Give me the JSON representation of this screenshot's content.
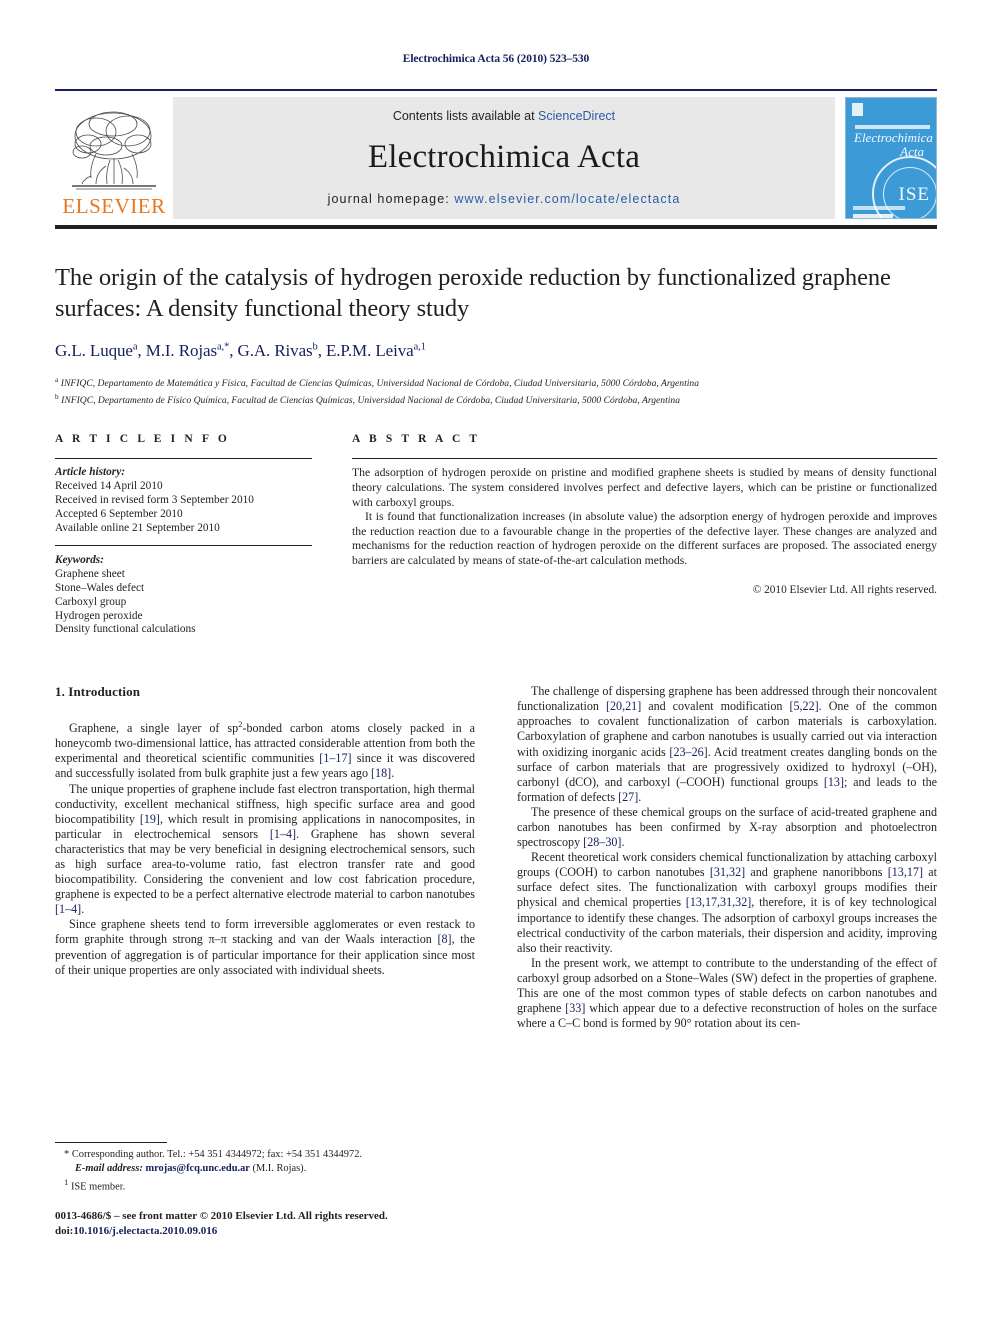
{
  "running_head": "Electrochimica Acta 56 (2010) 523–530",
  "masthead": {
    "publisher_name": "ELSEVIER",
    "contents_prefix": "Contents lists available at ",
    "contents_link": "ScienceDirect",
    "journal_name": "Electrochimica Acta",
    "homepage_prefix": "journal homepage: ",
    "homepage_url": "www.elsevier.com/locate/electacta",
    "cover": {
      "title_line1": "Electrochimica",
      "title_line2": "Acta",
      "society_mark": "ISE"
    },
    "accent_orange": "#e87722",
    "link_blue": "#2b5ca6",
    "rule_navy": "#16205c",
    "panel_grey": "#e8e8e8",
    "cover_blue": "#3c9bd6"
  },
  "article": {
    "title": "The origin of the catalysis of hydrogen peroxide reduction by functionalized graphene surfaces: A density functional theory study",
    "authors_html": "G.L. Luque<sup>a</sup>, M.I. Rojas<sup>a,</sup><sup>*</sup>, G.A. Rivas<sup>b</sup>, E.P.M. Leiva<sup>a,1</sup>",
    "affiliations": [
      {
        "marker": "a",
        "text": "INFIQC, Departamento de Matemática y Física, Facultad de Ciencias Químicas, Universidad Nacional de Córdoba, Ciudad Universitaria, 5000 Córdoba, Argentina"
      },
      {
        "marker": "b",
        "text": "INFIQC, Departamento de Físico Química, Facultad de Ciencias Químicas, Universidad Nacional de Córdoba, Ciudad Universitaria, 5000 Córdoba, Argentina"
      }
    ]
  },
  "article_info": {
    "heading": "A R T I C L E   I N F O",
    "history_label": "Article history:",
    "history": [
      "Received 14 April 2010",
      "Received in revised form 3 September 2010",
      "Accepted 6 September 2010",
      "Available online 21 September 2010"
    ],
    "keywords_label": "Keywords:",
    "keywords": [
      "Graphene sheet",
      "Stone–Wales defect",
      "Carboxyl group",
      "Hydrogen peroxide",
      "Density functional calculations"
    ]
  },
  "abstract": {
    "heading": "A B S T R A C T",
    "paragraph_1": "The adsorption of hydrogen peroxide on pristine and modified graphene sheets is studied by means of density functional theory calculations. The system considered involves perfect and defective layers, which can be pristine or functionalized with carboxyl groups.",
    "paragraph_2": "It is found that functionalization increases (in absolute value) the adsorption energy of hydrogen peroxide and improves the reduction reaction due to a favourable change in the properties of the defective layer. These changes are analyzed and mechanisms for the reduction reaction of hydrogen peroxide on the different surfaces are proposed. The associated energy barriers are calculated by means of state-of-the-art calculation methods.",
    "copyright": "© 2010 Elsevier Ltd. All rights reserved."
  },
  "introduction": {
    "section_title": "1.  Introduction",
    "left_paragraphs_html": [
      "Graphene, a single layer of sp<sup class=\"sup\">2</sup>-bonded carbon atoms closely packed in a honeycomb two-dimensional lattice, has attracted considerable attention from both the experimental and theoretical scientific communities <span class=\"ref\">[1–17]</span> since it was discovered and successfully isolated from bulk graphite just a few years ago <span class=\"ref\">[18]</span>.",
      "The unique properties of graphene include fast electron transportation, high thermal conductivity, excellent mechanical stiffness, high specific surface area and good biocompatibility <span class=\"ref\">[19]</span>, which result in promising applications in nanocomposites, in particular in electrochemical sensors <span class=\"ref\">[1–4]</span>. Graphene has shown several characteristics that may be very beneficial in designing electrochemical sensors, such as high surface area-to-volume ratio, fast electron transfer rate and good biocompatibility. Considering the convenient and low cost fabrication procedure, graphene is expected to be a perfect alternative electrode material to carbon nanotubes <span class=\"ref\">[1–4]</span>.",
      "Since graphene sheets tend to form irreversible agglomerates or even restack to form graphite through strong π–π stacking and van der Waals interaction <span class=\"ref\">[8]</span>, the prevention of aggregation is of particular importance for their application since most of their unique properties are only associated with individual sheets."
    ],
    "right_paragraphs_html": [
      "The challenge of dispersing graphene has been addressed through their noncovalent functionalization <span class=\"ref\">[20,21]</span> and covalent modification <span class=\"ref\">[5,22]</span>. One of the common approaches to covalent functionalization of carbon materials is carboxylation. Carboxylation of graphene and carbon nanotubes is usually carried out via interaction with oxidizing inorganic acids <span class=\"ref\">[23–26]</span>. Acid treatment creates dangling bonds on the surface of carbon materials that are progressively oxidized to hydroxyl (–OH), carbonyl (dCO), and carboxyl (–COOH) functional groups <span class=\"ref\">[13]</span>; and leads to the formation of defects <span class=\"ref\">[27]</span>.",
      "The presence of these chemical groups on the surface of acid-treated graphene and carbon nanotubes has been confirmed by X-ray absorption and photoelectron spectroscopy <span class=\"ref\">[28–30]</span>.",
      "Recent theoretical work considers chemical functionalization by attaching carboxyl groups (COOH) to carbon nanotubes <span class=\"ref\">[31,32]</span> and graphene nanoribbons <span class=\"ref\">[13,17]</span> at surface defect sites. The functionalization with carboxyl groups modifies their physical and chemical properties <span class=\"ref\">[13,17,31,32]</span>, therefore, it is of key technological importance to identify these changes. The adsorption of carboxyl groups increases the electrical conductivity of the carbon materials, their dispersion and acidity, improving also their reactivity.",
      "In the present work, we attempt to contribute to the understanding of the effect of carboxyl group adsorbed on a Stone–Wales (SW) defect in the properties of graphene. This are one of the most common types of stable defects on carbon nanotubes and graphene <span class=\"ref\">[33]</span> which appear due to a defective reconstruction of holes on the surface where a C–C bond is formed by 90° rotation about its cen-"
    ]
  },
  "footnotes": [
    {
      "marker": "*",
      "text": "Corresponding author. Tel.: +54 351 4344972; fax: +54 351 4344972."
    },
    {
      "marker": "",
      "label": "E-mail address:",
      "email": "mrojas@fcq.unc.edu.ar",
      "suffix": "(M.I. Rojas)."
    },
    {
      "marker": "1",
      "text": "ISE member."
    }
  ],
  "imprint": {
    "line1": "0013-4686/$ – see front matter © 2010 Elsevier Ltd. All rights reserved.",
    "doi_label": "doi:",
    "doi_value": "10.1016/j.electacta.2010.09.016"
  }
}
